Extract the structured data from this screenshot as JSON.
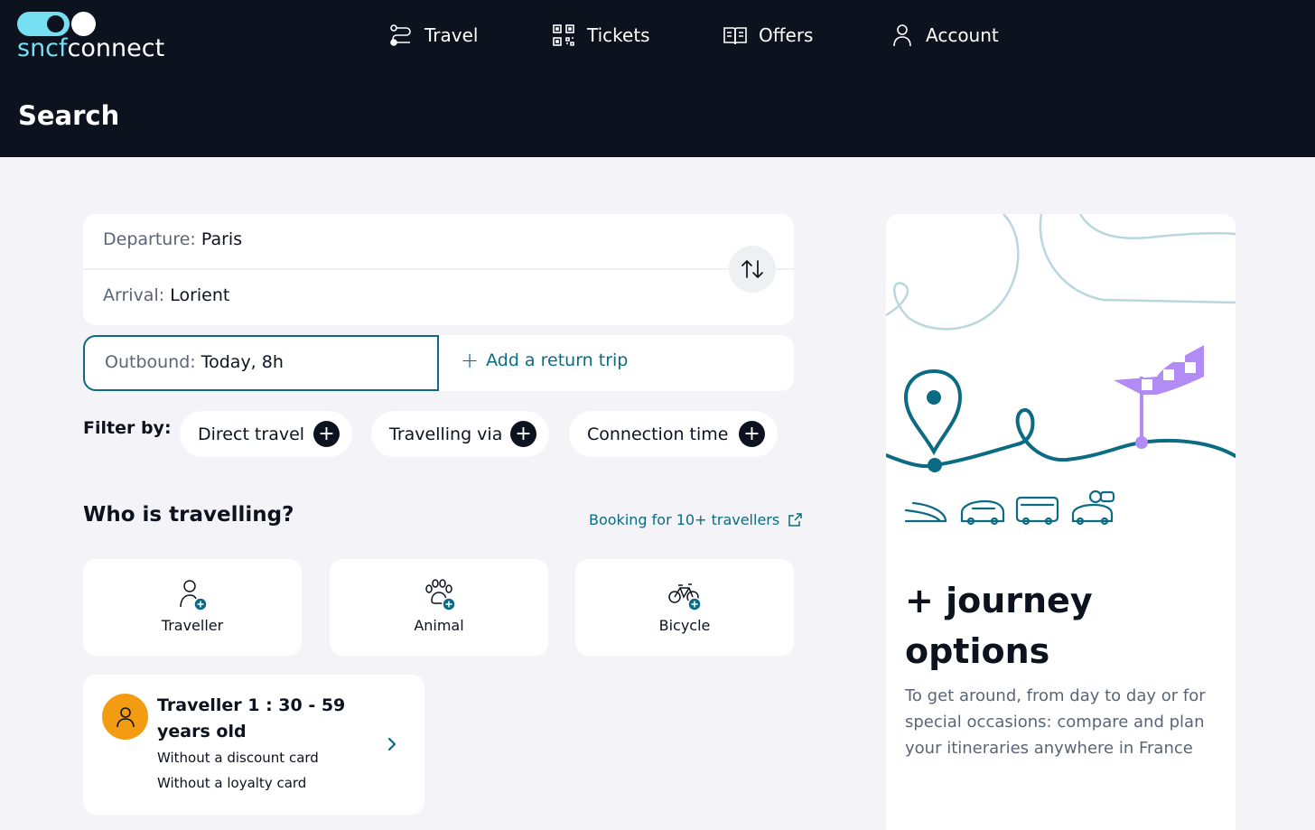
{
  "brand": {
    "part1": "sncf",
    "part2": "connect"
  },
  "nav": {
    "travel": "Travel",
    "tickets": "Tickets",
    "offers": "Offers",
    "account": "Account"
  },
  "page_title": "Search",
  "route": {
    "departure_label": "Departure:",
    "departure_value": "Paris",
    "arrival_label": "Arrival:",
    "arrival_value": "Lorient"
  },
  "dates": {
    "outbound_label": "Outbound:",
    "outbound_value": "Today, 8h",
    "return_label": "Add a return trip"
  },
  "filters": {
    "label": "Filter by:",
    "chips": [
      "Direct travel",
      "Travelling via",
      "Connection time"
    ]
  },
  "travellers": {
    "heading": "Who is travelling?",
    "booking_link": "Booking for 10+ travellers",
    "tiles": [
      "Traveller",
      "Animal",
      "Bicycle"
    ],
    "traveller1": {
      "name": "Traveller 1 :  30 - 59 years old",
      "discount": "Without a discount card",
      "loyalty": "Without a loyalty card"
    }
  },
  "promo": {
    "title_line1": "+ journey",
    "title_line2": "options",
    "text": "To get around, from day to day or for special occasions: compare and plan your itineraries anywhere in France"
  },
  "colors": {
    "header_bg": "#0c131f",
    "accent": "#0b6b83",
    "logo_cyan": "#76dff2",
    "avatar": "#f39c12",
    "flag": "#b38bf5"
  }
}
